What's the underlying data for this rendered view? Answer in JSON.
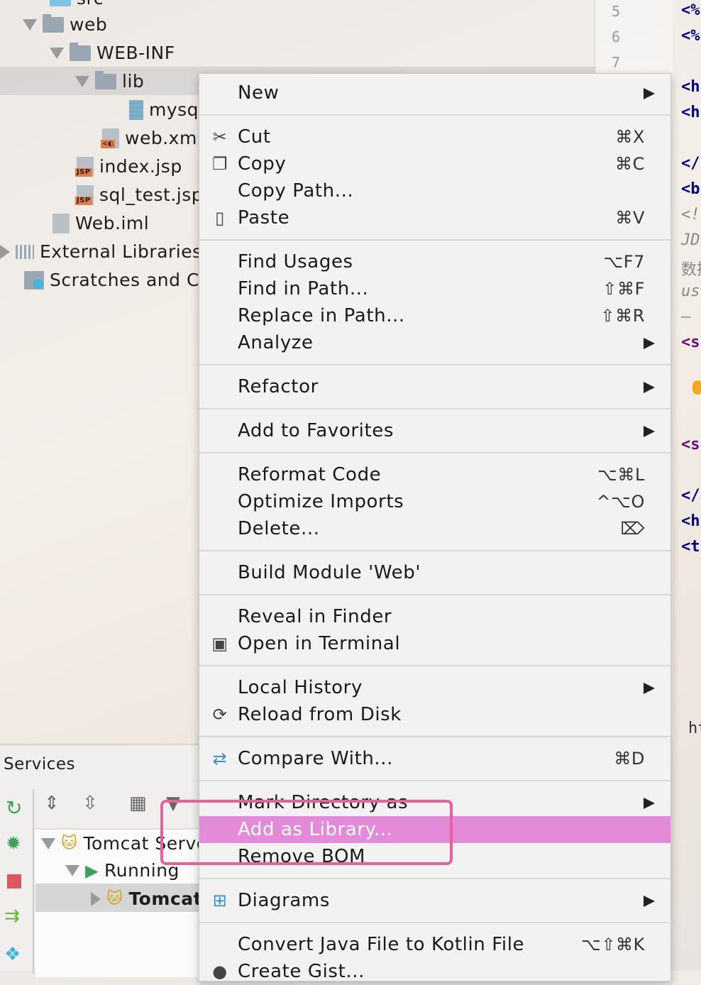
{
  "project_tree": {
    "items": [
      {
        "label": "src"
      },
      {
        "label": "web"
      },
      {
        "label": "WEB-INF"
      },
      {
        "label": "lib"
      },
      {
        "label": "mysq"
      },
      {
        "label": "web.xml"
      },
      {
        "label": "index.jsp"
      },
      {
        "label": "sql_test.jsp"
      },
      {
        "label": "Web.iml"
      },
      {
        "label": "External Libraries"
      },
      {
        "label": "Scratches and C"
      }
    ],
    "jsp_badge": "JSP"
  },
  "editor": {
    "line_numbers": [
      "5",
      "6",
      "7"
    ],
    "code_fragments": [
      "<%",
      "<%",
      "<h",
      "<h",
      "</",
      "<b",
      "<!",
      "JD",
      "数据",
      "us",
      "—",
      "<s",
      "<s",
      "</",
      "<h",
      "<t",
      "ht"
    ]
  },
  "context_menu": {
    "groups": [
      [
        {
          "label": "New",
          "submenu": true
        }
      ],
      [
        {
          "label": "Cut",
          "shortcut": "⌘X",
          "icon": "scissors-icon",
          "glyph": "✂"
        },
        {
          "label": "Copy",
          "shortcut": "⌘C",
          "icon": "copy-icon",
          "glyph": "❐"
        },
        {
          "label": "Copy Path..."
        },
        {
          "label": "Paste",
          "shortcut": "⌘V",
          "icon": "clipboard-icon",
          "glyph": "▯"
        }
      ],
      [
        {
          "label": "Find Usages",
          "shortcut": "⌥F7"
        },
        {
          "label": "Find in Path...",
          "shortcut": "⇧⌘F"
        },
        {
          "label": "Replace in Path...",
          "shortcut": "⇧⌘R"
        },
        {
          "label": "Analyze",
          "submenu": true
        }
      ],
      [
        {
          "label": "Refactor",
          "submenu": true
        }
      ],
      [
        {
          "label": "Add to Favorites",
          "submenu": true
        }
      ],
      [
        {
          "label": "Reformat Code",
          "shortcut": "⌥⌘L"
        },
        {
          "label": "Optimize Imports",
          "shortcut": "^⌥O"
        },
        {
          "label": "Delete...",
          "shortcut": "⌦"
        }
      ],
      [
        {
          "label": "Build Module 'Web'"
        }
      ],
      [
        {
          "label": "Reveal in Finder"
        },
        {
          "label": "Open in Terminal",
          "icon": "terminal-icon",
          "glyph": "▣"
        }
      ],
      [
        {
          "label": "Local History",
          "submenu": true
        },
        {
          "label": "Reload from Disk",
          "icon": "reload-icon",
          "glyph": "⟳"
        }
      ],
      [
        {
          "label": "Compare With...",
          "shortcut": "⌘D",
          "icon": "compare-icon",
          "glyph": "⇄"
        }
      ],
      [
        {
          "label": "Mark Directory as",
          "submenu": true
        },
        {
          "label": "Add as Library...",
          "highlighted": true
        },
        {
          "label": "Remove BOM"
        }
      ],
      [
        {
          "label": "Diagrams",
          "submenu": true,
          "icon": "diagram-icon",
          "glyph": "⊞"
        }
      ],
      [
        {
          "label": "Convert Java File to Kotlin File",
          "shortcut": "⌥⇧⌘K"
        },
        {
          "label": "Create Gist...",
          "icon": "github-icon",
          "glyph": "●"
        }
      ]
    ],
    "highlight_color": "#e38bd8",
    "annotation_box_color": "#e8629a"
  },
  "services": {
    "title": "Services",
    "tree": [
      {
        "label": "Tomcat Server"
      },
      {
        "label": "Running"
      },
      {
        "label": "Tomcat"
      }
    ]
  }
}
